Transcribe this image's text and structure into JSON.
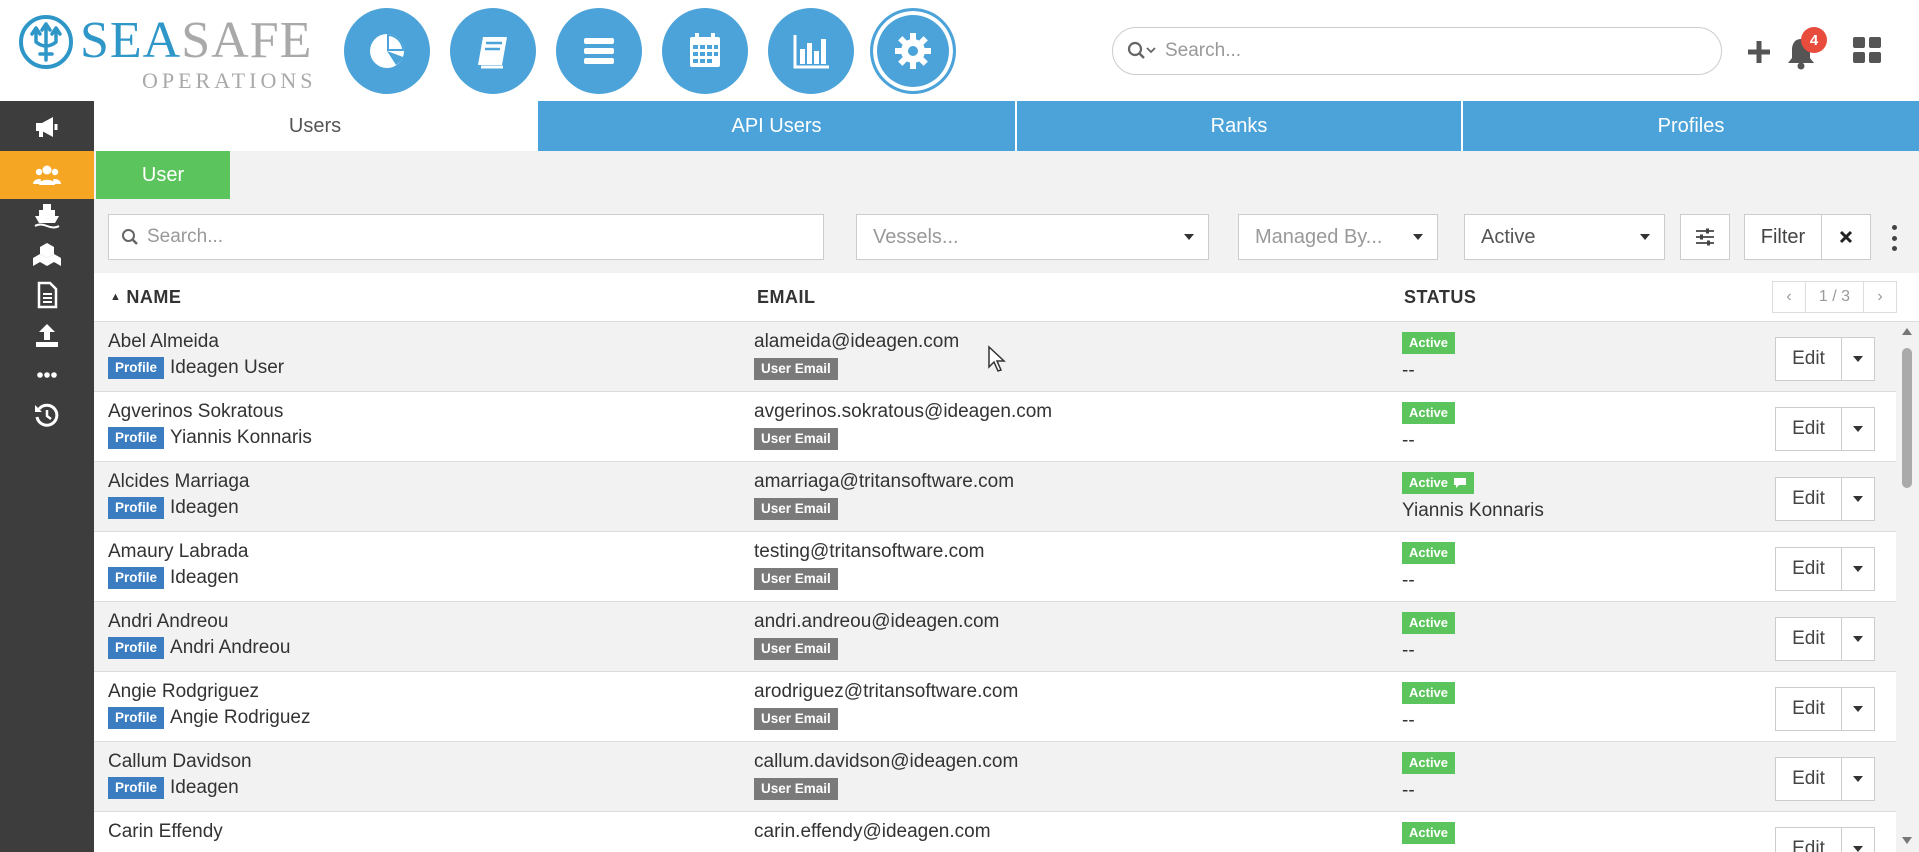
{
  "brand": {
    "sea": "SEA",
    "safe": "SAFE",
    "sub": "OPERATIONS"
  },
  "nav_circles": [
    "dashboard-icon",
    "book-icon",
    "list-icon",
    "calendar-icon",
    "bar-chart-icon",
    "gear-icon"
  ],
  "header": {
    "search_placeholder": "Search...",
    "notification_count": "4"
  },
  "sidebar": [
    "megaphone-icon",
    "users-icon",
    "ship-icon",
    "cubes-icon",
    "document-icon",
    "upload-icon",
    "more-icon",
    "history-icon"
  ],
  "tabs": [
    "Users",
    "API Users",
    "Ranks",
    "Profiles"
  ],
  "subtab": "User",
  "filters": {
    "search_placeholder": "Search...",
    "vessels_placeholder": "Vessels...",
    "managed_placeholder": "Managed By...",
    "status_value": "Active",
    "filter_label": "Filter"
  },
  "table": {
    "headers": {
      "name": "NAME",
      "email": "EMAIL",
      "status": "STATUS"
    },
    "pager": "1 / 3",
    "profile_tag": "Profile",
    "email_tag": "User Email",
    "edit_label": "Edit",
    "rows": [
      {
        "name": "Abel Almeida",
        "profile": "Ideagen User",
        "email": "alameida@ideagen.com",
        "status": "Active",
        "managed": "--"
      },
      {
        "name": "Agverinos Sokratous",
        "profile": "Yiannis Konnaris",
        "email": "avgerinos.sokratous@ideagen.com",
        "status": "Active",
        "managed": "--"
      },
      {
        "name": "Alcides Marriaga",
        "profile": "Ideagen",
        "email": "amarriaga@tritansoftware.com",
        "status": "Active",
        "managed": "Yiannis Konnaris"
      },
      {
        "name": "Amaury Labrada",
        "profile": "Ideagen",
        "email": "testing@tritansoftware.com",
        "status": "Active",
        "managed": "--"
      },
      {
        "name": "Andri Andreou",
        "profile": "Andri Andreou",
        "email": "andri.andreou@ideagen.com",
        "status": "Active",
        "managed": "--"
      },
      {
        "name": "Angie Rodgriguez",
        "profile": "Angie Rodriguez",
        "email": "arodriguez@tritansoftware.com",
        "status": "Active",
        "managed": "--"
      },
      {
        "name": "Callum Davidson",
        "profile": "Ideagen",
        "email": "callum.davidson@ideagen.com",
        "status": "Active",
        "managed": "--"
      },
      {
        "name": "Carin Effendy",
        "profile": "",
        "email": "carin.effendy@ideagen.com",
        "status": "Active",
        "managed": ""
      }
    ]
  },
  "colors": {
    "primary": "#4ba3d9",
    "accent": "#f5a623",
    "success": "#5cc45c",
    "danger": "#e74c3c"
  }
}
